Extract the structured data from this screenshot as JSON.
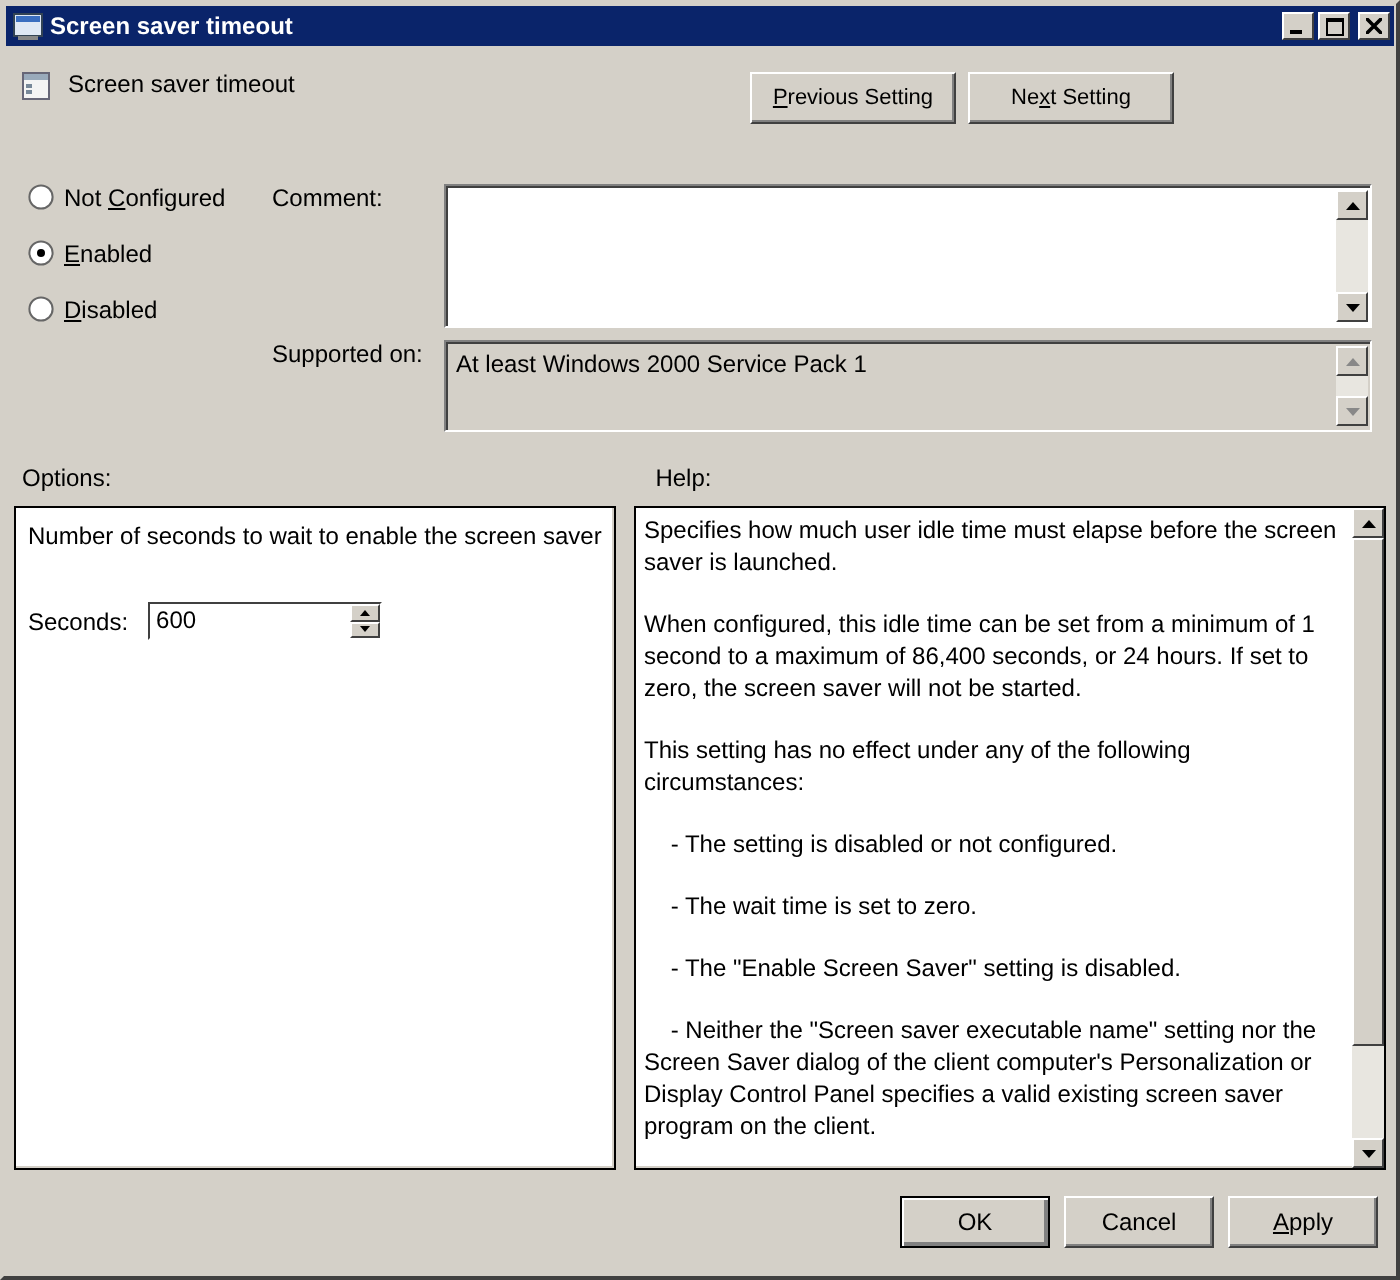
{
  "window": {
    "title": "Screen saver timeout"
  },
  "header": {
    "title": "Screen saver timeout"
  },
  "nav_buttons": [
    {
      "label": {
        "key": "P",
        "post": "revious Setting"
      }
    },
    {
      "label": {
        "pre": "Ne",
        "key": "x",
        "post": "t Setting"
      }
    }
  ],
  "state_options": [
    {
      "label": {
        "pre": "Not ",
        "key": "C",
        "post": "onfigured"
      },
      "selected": false
    },
    {
      "label": {
        "key": "E",
        "post": "nabled"
      },
      "selected": true
    },
    {
      "label": {
        "key": "D",
        "post": "isabled"
      },
      "selected": false
    }
  ],
  "comment": {
    "label": "Comment:"
  },
  "supported_on": {
    "label": "Supported on:",
    "value": "At least Windows 2000 Service Pack 1"
  },
  "options": {
    "label": "Options:",
    "description": "Number of seconds to wait to enable the screen saver",
    "seconds_label": "Seconds:",
    "seconds_value": "600"
  },
  "help": {
    "label": "Help:",
    "paragraphs": [
      "Specifies how much user idle time must elapse before the screen saver is launched.",
      "When configured, this idle time can be set from a minimum of 1 second to a maximum of 86,400 seconds, or 24 hours. If set to zero, the screen saver will not be started.",
      "This setting has no effect under any of the following circumstances:",
      "    - The setting is disabled or not configured.",
      "    - The wait time is set to zero.",
      "    - The \"Enable Screen Saver\" setting is disabled.",
      "    - Neither the \"Screen saver executable name\" setting nor the Screen Saver dialog of the client computer's Personalization or Display Control Panel specifies a valid existing screen saver program on the client."
    ]
  },
  "footer_buttons": [
    {
      "label": {
        "pre": "OK"
      },
      "kind": "default"
    },
    {
      "label": {
        "pre": "Cancel"
      },
      "kind": "normal"
    },
    {
      "label": {
        "key": "A",
        "post": "pply"
      },
      "kind": "normal"
    }
  ]
}
